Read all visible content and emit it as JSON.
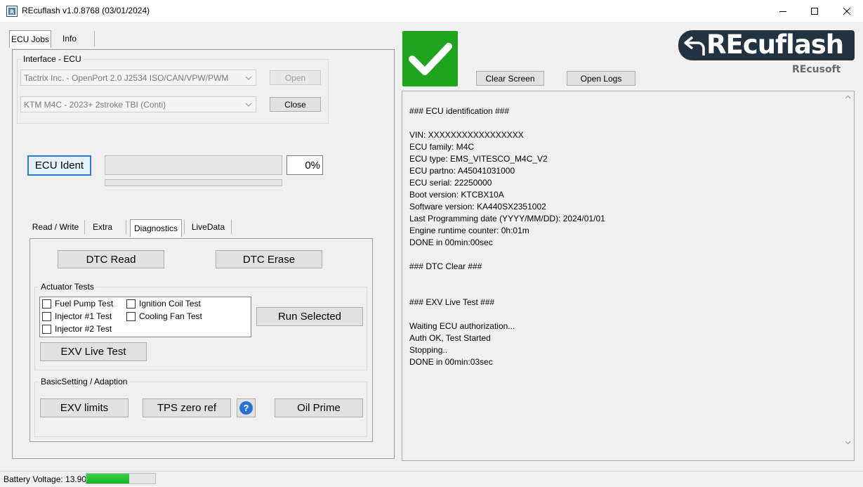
{
  "window": {
    "title": "REcuflash  v1.0.8768 (03/01/2024)"
  },
  "main_tabs": [
    {
      "label": "ECU Jobs",
      "selected": true
    },
    {
      "label": "Info",
      "selected": false
    }
  ],
  "interface": {
    "group_label": "Interface - ECU",
    "adapter_value": "Tactrix Inc. - OpenPort 2.0 J2534 ISO/CAN/VPW/PWM",
    "ecu_value": "KTM M4C - 2023+ 2stroke TBI (Conti)",
    "open_label": "Open",
    "close_label": "Close"
  },
  "ident": {
    "button_label": "ECU Ident",
    "progress_text": "0%",
    "progress_value": 0
  },
  "sub_tabs": [
    {
      "label": "Read / Write",
      "selected": false
    },
    {
      "label": "Extra",
      "selected": false
    },
    {
      "label": "Diagnostics",
      "selected": true
    },
    {
      "label": "LiveData",
      "selected": false
    }
  ],
  "diagnostics": {
    "dtc_read_label": "DTC Read",
    "dtc_erase_label": "DTC Erase",
    "actuator_group_label": "Actuator Tests",
    "actuator_tests": [
      {
        "label": "Fuel Pump Test",
        "checked": false
      },
      {
        "label": "Injector #1 Test",
        "checked": false
      },
      {
        "label": "Injector #2 Test",
        "checked": false
      },
      {
        "label": "Ignition Coil Test",
        "checked": false
      },
      {
        "label": "Cooling Fan Test",
        "checked": false
      }
    ],
    "run_selected_label": "Run Selected",
    "exv_live_test_label": "EXV Live Test",
    "basic_group_label": "BasicSetting / Adaption",
    "exv_limits_label": "EXV limits",
    "tps_zero_label": "TPS zero ref",
    "help_label": "?",
    "oil_prime_label": "Oil Prime"
  },
  "toolbar": {
    "clear_screen_label": "Clear Screen",
    "open_logs_label": "Open Logs"
  },
  "logo": {
    "brand_text": "REcuflash",
    "sub_text": "REcusoft"
  },
  "log_lines": [
    "### ECU identification ###",
    "",
    "VIN: XXXXXXXXXXXXXXXXX",
    "ECU family: M4C",
    "ECU type: EMS_VITESCO_M4C_V2",
    "ECU partno: A45041031000",
    "ECU serial: 22250000",
    "Boot version: KTCBX10A",
    "Software version: KA440SX2351002",
    "Last Programming date (YYYY/MM/DD): 2024/01/01",
    "Engine runtime counter: 0h:01m",
    "DONE in 00min:00sec",
    "",
    "### DTC Clear ###",
    "",
    "",
    "### EXV Live Test ###",
    "",
    "Waiting ECU authorization...",
    "Auth OK, Test Started",
    "Stopping..",
    "DONE in 00min:03sec"
  ],
  "status": {
    "battery_text": "Battery Voltage: 13.90",
    "battery_level_percent": 62
  },
  "colors": {
    "accent_blue": "#2c7bd1",
    "success_green": "#1fa41f",
    "battery_green": "#1cc12c",
    "logo_dark": "#233240",
    "help_blue": "#2a6fd6"
  }
}
